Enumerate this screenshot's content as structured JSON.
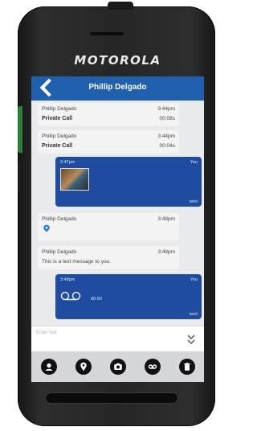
{
  "device": {
    "brand": "MOTOROLA"
  },
  "header": {
    "title": "Phillip Delgado"
  },
  "messages": [
    {
      "sender": "Phillip Delgado",
      "time": "3:44pm",
      "label": "Private Call",
      "duration": "00:08s"
    },
    {
      "sender": "Phillip Delgado",
      "time": "3:44pm",
      "label": "Private Call",
      "duration": "00:04s"
    },
    {
      "time": "3:47pm",
      "who": "You",
      "status": "sent"
    },
    {
      "sender": "Phillip Delgado",
      "time": "3:48pm"
    },
    {
      "sender": "Phillip Delgado",
      "time": "3:48pm",
      "text": "This is a text message to you."
    },
    {
      "time": "3:48pm",
      "who": "You",
      "duration": "00:00",
      "status": "sent"
    }
  ],
  "composer": {
    "placeholder": "Enter text"
  },
  "toolbar": [
    "contacts-icon",
    "location-icon",
    "camera-icon",
    "voicemail-icon",
    "delete-icon"
  ],
  "colors": {
    "header": "#1f5fae",
    "outgoing": "#1f4c9e",
    "screen_bg": "#e9eaee"
  }
}
